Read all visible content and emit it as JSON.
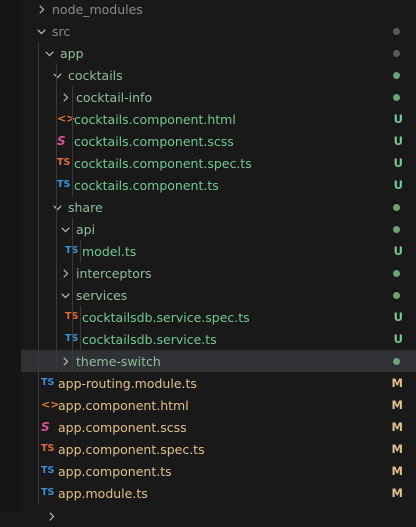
{
  "colors": {
    "background": "#191919",
    "selected_row": "#2f3134",
    "untracked": "#73c991",
    "modified": "#e2c08d",
    "folder_label": "#8fbe9a",
    "ts_icon": "#3c90d7",
    "spec_icon": "#e26a3e",
    "html_icon": "#e37933",
    "scss_icon": "#d4509c"
  },
  "icons": {
    "ts": "TS",
    "html": "<>",
    "scss": "S",
    "chevron_right": "chevron-right-icon",
    "chevron_down": "chevron-down-icon"
  },
  "tree": [
    {
      "name": "node_modules",
      "type": "folder",
      "expanded": false,
      "status": "",
      "dot": "",
      "label_style": "dim"
    },
    {
      "name": "src",
      "type": "folder",
      "expanded": true,
      "status": "",
      "dot": "grey",
      "label_style": "dim"
    },
    {
      "name": "app",
      "type": "folder",
      "expanded": true,
      "status": "",
      "dot": "grey",
      "label_style": "folder-green"
    },
    {
      "name": "cocktails",
      "type": "folder",
      "expanded": true,
      "status": "",
      "dot": "green",
      "label_style": "folder-green"
    },
    {
      "name": "cocktail-info",
      "type": "folder",
      "expanded": false,
      "status": "",
      "dot": "green",
      "label_style": "folder-green"
    },
    {
      "name": "cocktails.component.html",
      "type": "html",
      "status": "U",
      "label_style": "file-green"
    },
    {
      "name": "cocktails.component.scss",
      "type": "scss",
      "status": "U",
      "label_style": "file-green"
    },
    {
      "name": "cocktails.component.spec.ts",
      "type": "spec",
      "status": "U",
      "label_style": "file-green"
    },
    {
      "name": "cocktails.component.ts",
      "type": "ts",
      "status": "U",
      "label_style": "file-green"
    },
    {
      "name": "share",
      "type": "folder",
      "expanded": true,
      "status": "",
      "dot": "green",
      "label_style": "folder-green"
    },
    {
      "name": "api",
      "type": "folder",
      "expanded": true,
      "status": "",
      "dot": "green",
      "label_style": "folder-green"
    },
    {
      "name": "model.ts",
      "type": "ts",
      "status": "U",
      "label_style": "file-green"
    },
    {
      "name": "interceptors",
      "type": "folder",
      "expanded": false,
      "status": "",
      "dot": "green",
      "label_style": "folder-green"
    },
    {
      "name": "services",
      "type": "folder",
      "expanded": true,
      "status": "",
      "dot": "green",
      "label_style": "folder-green"
    },
    {
      "name": "cocktailsdb.service.spec.ts",
      "type": "spec",
      "status": "U",
      "label_style": "file-green"
    },
    {
      "name": "cocktailsdb.service.ts",
      "type": "ts",
      "status": "U",
      "label_style": "file-green"
    },
    {
      "name": "theme-switch",
      "type": "folder",
      "expanded": false,
      "status": "",
      "dot": "green",
      "label_style": "folder-green",
      "selected": true
    },
    {
      "name": "app-routing.module.ts",
      "type": "ts",
      "status": "M",
      "label_style": "file-yellow"
    },
    {
      "name": "app.component.html",
      "type": "html",
      "status": "M",
      "label_style": "file-yellow"
    },
    {
      "name": "app.component.scss",
      "type": "scss",
      "status": "M",
      "label_style": "file-yellow"
    },
    {
      "name": "app.component.spec.ts",
      "type": "spec",
      "status": "M",
      "label_style": "file-yellow"
    },
    {
      "name": "app.component.ts",
      "type": "ts",
      "status": "M",
      "label_style": "file-yellow"
    },
    {
      "name": "app.module.ts",
      "type": "ts",
      "status": "M",
      "label_style": "file-yellow"
    }
  ]
}
